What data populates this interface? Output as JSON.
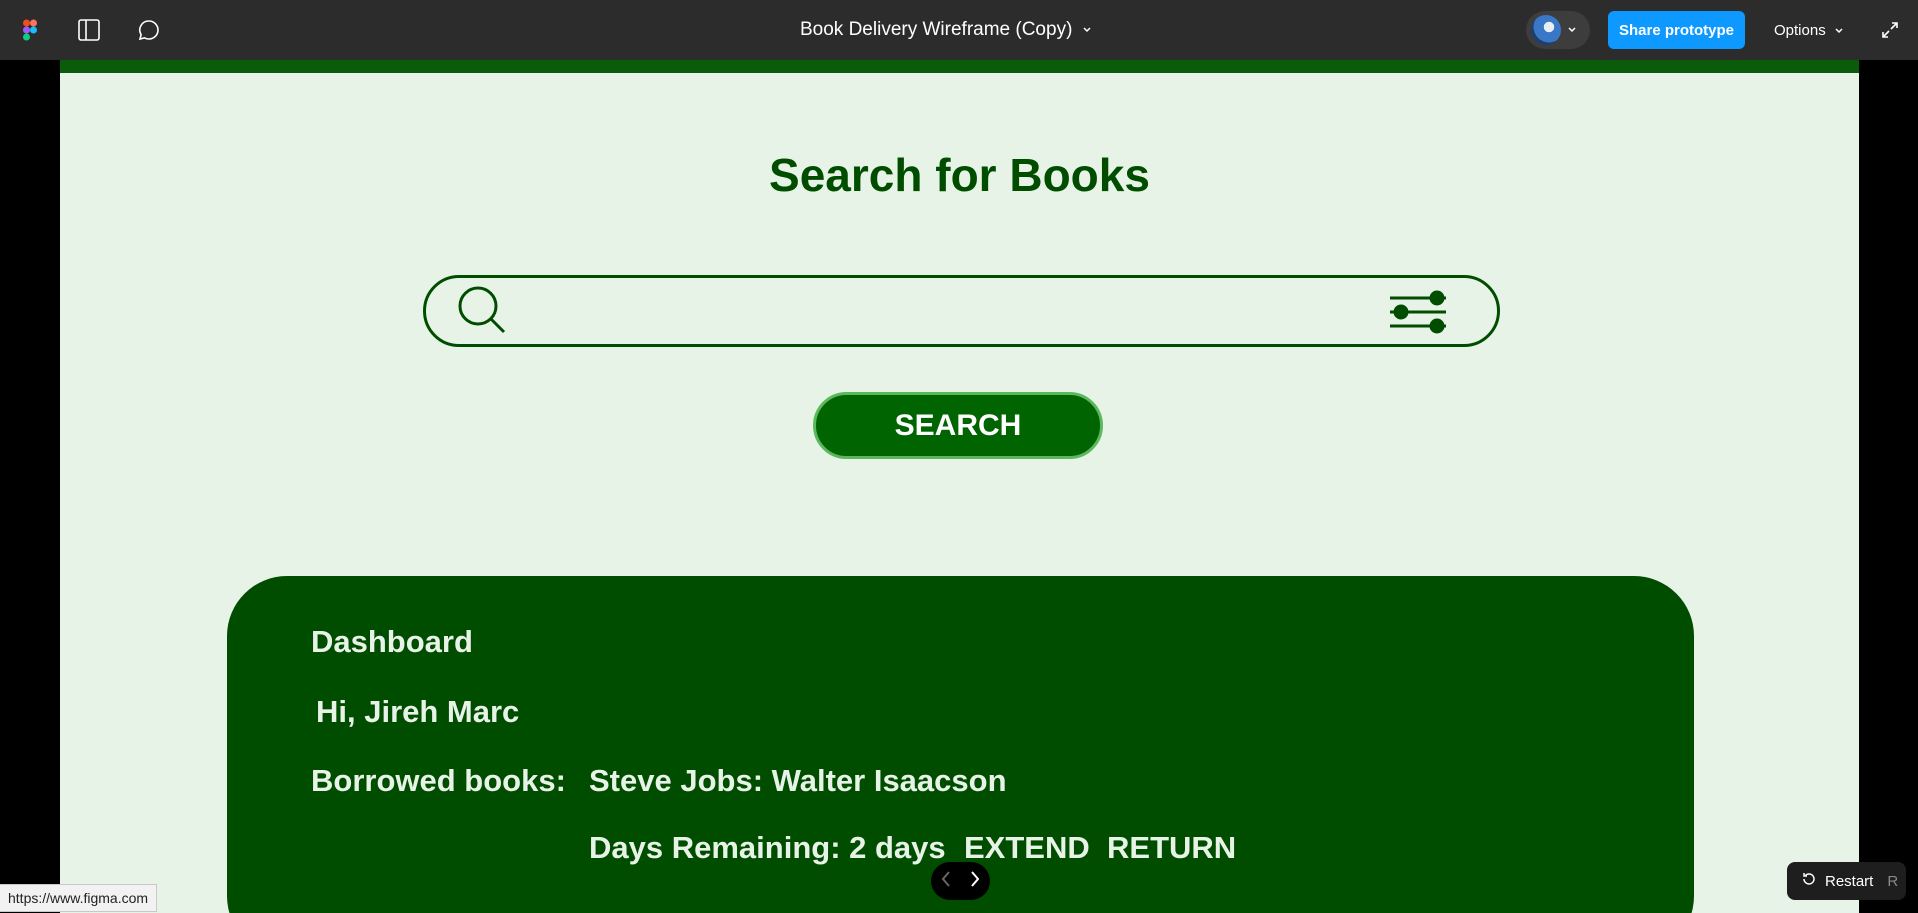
{
  "toolbar": {
    "title": "Book Delivery Wireframe (Copy)",
    "share_label": "Share prototype",
    "options_label": "Options",
    "icons": [
      "figma-logo-icon",
      "sidebar-toggle-icon",
      "comment-icon",
      "chevron-down-icon",
      "expand-icon"
    ]
  },
  "page": {
    "title": "Search for Books",
    "search_button": "SEARCH",
    "search_placeholder": ""
  },
  "dashboard": {
    "title": "Dashboard",
    "greeting": "Hi, Jireh Marc",
    "borrowed_label": "Borrowed books:",
    "book": "Steve Jobs: Walter Isaacson",
    "days_remaining": "Days Remaining: 2 days",
    "extend_label": "EXTEND",
    "return_label": "RETURN"
  },
  "controls": {
    "restart_label": "Restart",
    "restart_shortcut": "R"
  },
  "status_bar": {
    "url": "https://www.figma.com"
  },
  "colors": {
    "toolbar_bg": "#2c2c2c",
    "accent_blue": "#0d99ff",
    "frame_bg": "#e8f3e8",
    "dark_green": "#004d00",
    "button_green": "#006400"
  }
}
